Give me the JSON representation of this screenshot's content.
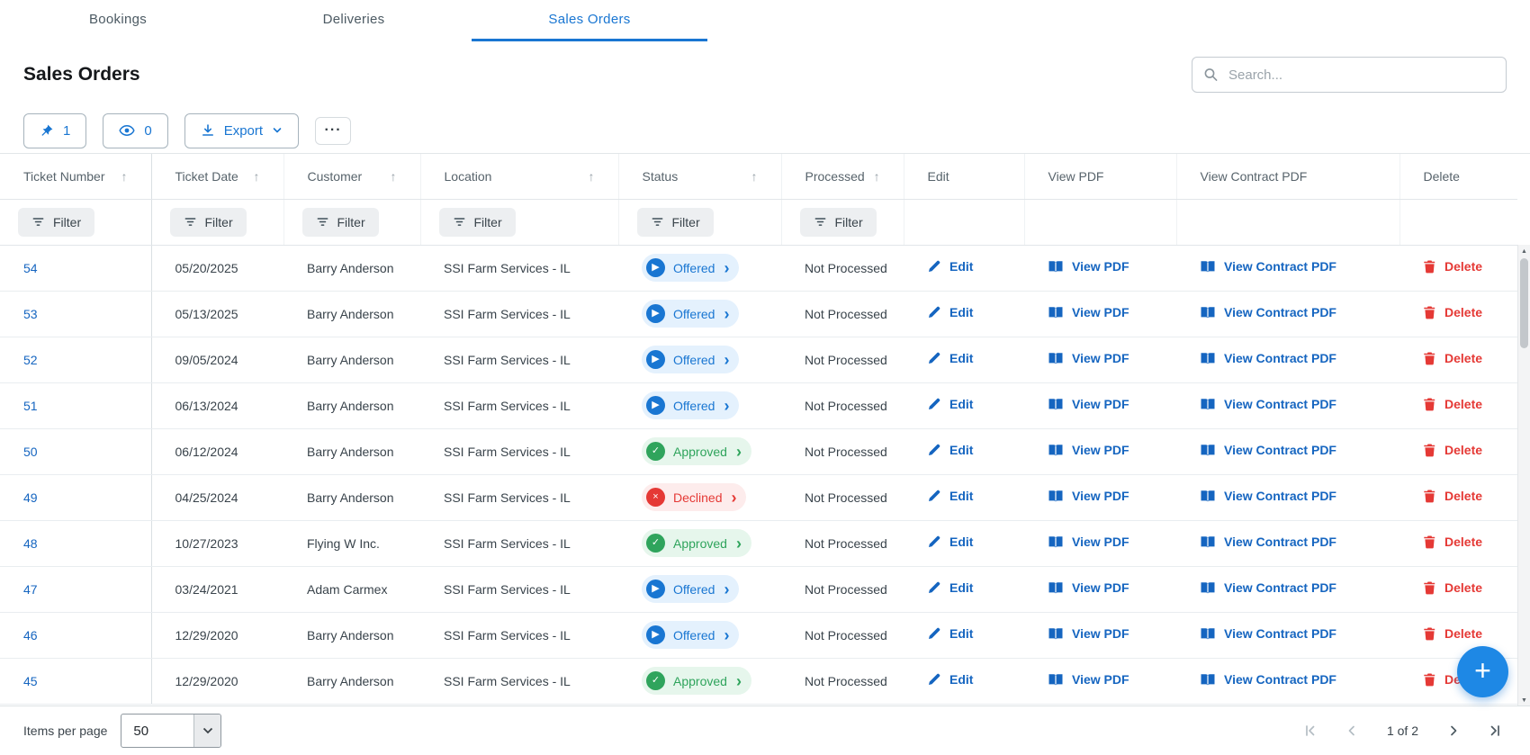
{
  "page_title": "Sales Orders",
  "tabs": [
    {
      "label": "Bookings",
      "active": false
    },
    {
      "label": "Deliveries",
      "active": false
    },
    {
      "label": "Sales Orders",
      "active": true
    }
  ],
  "search": {
    "placeholder": "Search..."
  },
  "toolbar": {
    "pinned_count": "1",
    "hidden_count": "0",
    "export_label": "Export"
  },
  "table": {
    "filter_label": "Filter",
    "columns": [
      {
        "label": "Ticket Number",
        "sortable": true,
        "filter": true
      },
      {
        "label": "Ticket Date",
        "sortable": true,
        "filter": true
      },
      {
        "label": "Customer",
        "sortable": true,
        "filter": true
      },
      {
        "label": "Location",
        "sortable": true,
        "filter": true
      },
      {
        "label": "Status",
        "sortable": true,
        "filter": true
      },
      {
        "label": "Processed",
        "sortable": true,
        "filter": true
      },
      {
        "label": "Edit",
        "sortable": false,
        "filter": false
      },
      {
        "label": "View PDF",
        "sortable": false,
        "filter": false
      },
      {
        "label": "View Contract PDF",
        "sortable": false,
        "filter": false
      },
      {
        "label": "Delete",
        "sortable": false,
        "filter": false
      }
    ],
    "actions": {
      "edit": "Edit",
      "view_pdf": "View PDF",
      "view_contract_pdf": "View Contract PDF",
      "delete": "Delete"
    },
    "rows": [
      {
        "ticket_number": "54",
        "ticket_date": "05/20/2025",
        "customer": "Barry Anderson",
        "location": "SSI Farm Services - IL",
        "status": "Offered",
        "processed": "Not Processed"
      },
      {
        "ticket_number": "53",
        "ticket_date": "05/13/2025",
        "customer": "Barry Anderson",
        "location": "SSI Farm Services - IL",
        "status": "Offered",
        "processed": "Not Processed"
      },
      {
        "ticket_number": "52",
        "ticket_date": "09/05/2024",
        "customer": "Barry Anderson",
        "location": "SSI Farm Services - IL",
        "status": "Offered",
        "processed": "Not Processed"
      },
      {
        "ticket_number": "51",
        "ticket_date": "06/13/2024",
        "customer": "Barry Anderson",
        "location": "SSI Farm Services - IL",
        "status": "Offered",
        "processed": "Not Processed"
      },
      {
        "ticket_number": "50",
        "ticket_date": "06/12/2024",
        "customer": "Barry Anderson",
        "location": "SSI Farm Services - IL",
        "status": "Approved",
        "processed": "Not Processed"
      },
      {
        "ticket_number": "49",
        "ticket_date": "04/25/2024",
        "customer": "Barry Anderson",
        "location": "SSI Farm Services - IL",
        "status": "Declined",
        "processed": "Not Processed"
      },
      {
        "ticket_number": "48",
        "ticket_date": "10/27/2023",
        "customer": "Flying W Inc.",
        "location": "SSI Farm Services - IL",
        "status": "Approved",
        "processed": "Not Processed"
      },
      {
        "ticket_number": "47",
        "ticket_date": "03/24/2021",
        "customer": "Adam Carmex",
        "location": "SSI Farm Services - IL",
        "status": "Offered",
        "processed": "Not Processed"
      },
      {
        "ticket_number": "46",
        "ticket_date": "12/29/2020",
        "customer": "Barry Anderson",
        "location": "SSI Farm Services - IL",
        "status": "Offered",
        "processed": "Not Processed"
      },
      {
        "ticket_number": "45",
        "ticket_date": "12/29/2020",
        "customer": "Barry Anderson",
        "location": "SSI Farm Services - IL",
        "status": "Approved",
        "processed": "Not Processed"
      }
    ]
  },
  "footer": {
    "items_per_page_label": "Items per page",
    "items_per_page_value": "50",
    "page_info": "1 of 2"
  },
  "icons": {
    "sort_asc": "↑",
    "chevron_right": "›",
    "ellipsis": "···",
    "plus": "+",
    "scroll_up": "▲",
    "scroll_down": "▼",
    "status_glyphs": {
      "Offered": "▶",
      "Approved": "✓",
      "Declined": "×"
    }
  },
  "colors": {
    "accent": "#1976d2",
    "link": "#1565c0",
    "delete_red": "#e53935",
    "status": {
      "Offered": {
        "fg": "#1976d2",
        "bg": "#e4f1fd"
      },
      "Approved": {
        "fg": "#2fa45c",
        "bg": "#e6f6ec"
      },
      "Declined": {
        "fg": "#e53935",
        "bg": "#fdecec"
      }
    }
  }
}
